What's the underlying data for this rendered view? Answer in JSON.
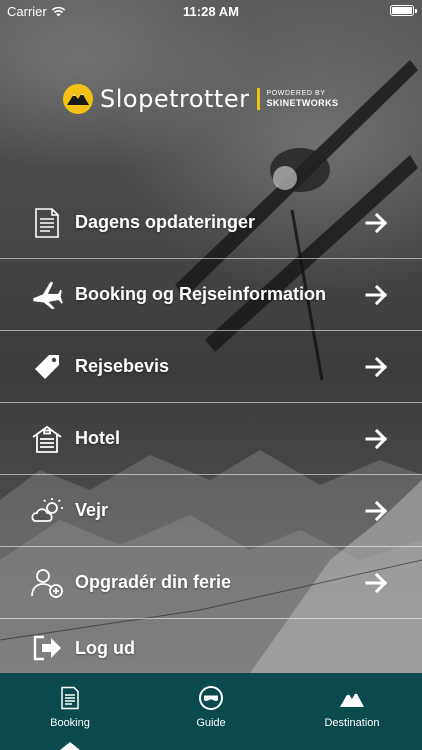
{
  "status_bar": {
    "carrier": "Carrier",
    "time": "11:28 AM"
  },
  "brand": {
    "name": "Slopetrotter",
    "powered_line1": "POWDERED BY",
    "powered_line2": "SKINETWORKS",
    "accent_color": "#f2c114"
  },
  "menu": {
    "items": [
      {
        "label": "Dagens opdateringer",
        "icon": "document-icon"
      },
      {
        "label": "Booking og Rejseinformation",
        "icon": "airplane-icon"
      },
      {
        "label": "Rejsebevis",
        "icon": "tag-icon"
      },
      {
        "label": "Hotel",
        "icon": "hotel-icon"
      },
      {
        "label": "Vejr",
        "icon": "weather-icon"
      },
      {
        "label": "Opgradér din ferie",
        "icon": "add-user-icon"
      },
      {
        "label": "Log ud",
        "icon": "logout-icon"
      }
    ]
  },
  "tabbar": {
    "background": "#0b4a4c",
    "tabs": [
      {
        "label": "Booking",
        "icon": "booking-icon",
        "selected": true
      },
      {
        "label": "Guide",
        "icon": "guide-icon",
        "selected": false
      },
      {
        "label": "Destination",
        "icon": "mountain-icon",
        "selected": false
      }
    ]
  }
}
